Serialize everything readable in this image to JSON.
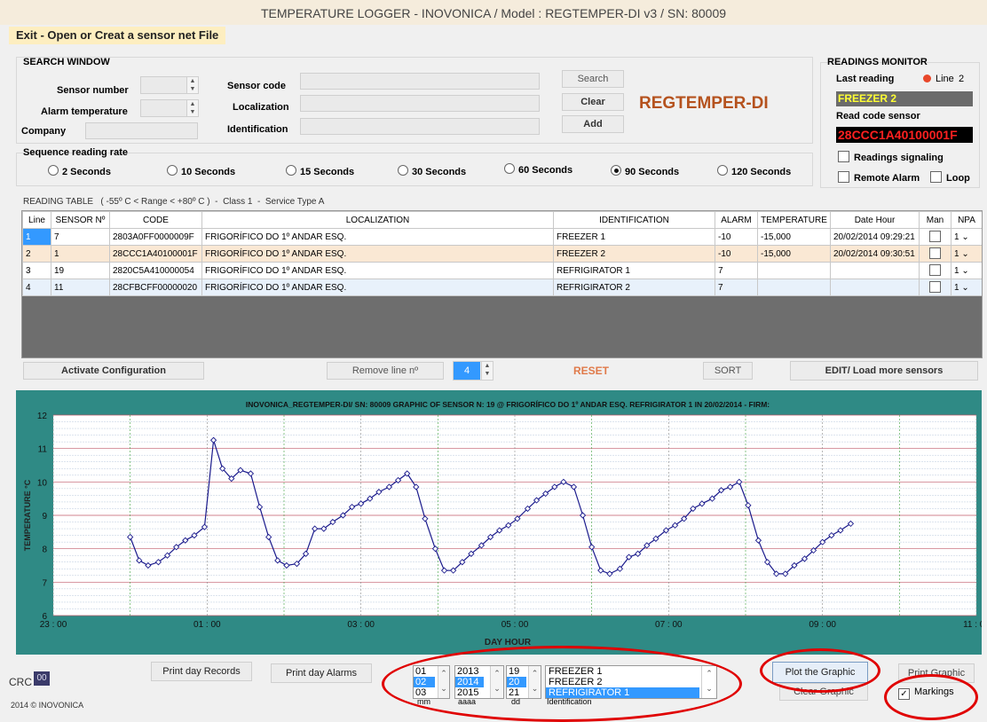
{
  "window": {
    "title": "TEMPERATURE LOGGER  - INOVONICA  / Model : REGTEMPER-DI v3  / SN:  80009"
  },
  "menu": {
    "exit_label": "Exit - Open or Creat a sensor net File"
  },
  "search": {
    "title": "SEARCH WINDOW",
    "sensor_number_label": "Sensor number",
    "alarm_temperature_label": "Alarm temperature",
    "company_label": "Company",
    "sensor_code_label": "Sensor code",
    "localization_label": "Localization",
    "identification_label": "Identification",
    "search_button": "Search",
    "clear_button": "Clear",
    "add_button": "Add",
    "brand": "REGTEMPER-DI"
  },
  "monitor": {
    "title": "READINGS MONITOR",
    "last_reading_label": "Last reading",
    "line_label": "Line",
    "line_value": "2",
    "last_reading_value": "FREEZER 2",
    "read_code_label": "Read code sensor",
    "read_code_value": "28CCC1A40100001F",
    "signaling_label": "Readings signaling",
    "remote_alarm_label": "Remote Alarm",
    "loop_label": "Loop"
  },
  "rate": {
    "title": "Sequence reading rate",
    "options": [
      "2 Seconds",
      "10 Seconds",
      "15 Seconds",
      "30 Seconds",
      "60 Seconds",
      "90 Seconds",
      "120 Seconds"
    ],
    "selected": "90 Seconds"
  },
  "table": {
    "caption": "READING TABLE   ( -55º C < Range < +80º C )  -  Class 1  -  Service Type A",
    "headers": [
      "Line",
      "SENSOR Nº",
      "CODE",
      "LOCALIZATION",
      "IDENTIFICATION",
      "ALARM",
      "TEMPERATURE",
      "Date Hour",
      "Man",
      "NPA"
    ],
    "rows": [
      {
        "line": "1",
        "sensor": "7",
        "code": "2803A0FF0000009F",
        "loc": "FRIGORÍFICO DO 1º ANDAR ESQ.",
        "ident": "FREEZER 1",
        "alarm": "-10",
        "temp": "-15,000",
        "date": "20/02/2014 09:29:21",
        "npa": "1"
      },
      {
        "line": "2",
        "sensor": "1",
        "code": "28CCC1A40100001F",
        "loc": "FRIGORÍFICO DO 1º ANDAR ESQ.",
        "ident": "FREEZER 2",
        "alarm": "-10",
        "temp": "-15,000",
        "date": "20/02/2014 09:30:51",
        "npa": "1"
      },
      {
        "line": "3",
        "sensor": "19",
        "code": "2820C5A410000054",
        "loc": "FRIGORÍFICO DO 1º ANDAR ESQ.",
        "ident": "REFRIGIRATOR 1",
        "alarm": "7",
        "temp": "",
        "date": "",
        "npa": "1"
      },
      {
        "line": "4",
        "sensor": "11",
        "code": "28CFBCFF00000020",
        "loc": "FRIGORÍFICO DO 1º ANDAR ESQ.",
        "ident": "REFRIGIRATOR 2",
        "alarm": "7",
        "temp": "",
        "date": "",
        "npa": "1"
      }
    ]
  },
  "actions": {
    "activate": "Activate Configuration",
    "remove_line": "Remove line  nº",
    "remove_value": "4",
    "reset": "RESET",
    "sort": "SORT",
    "edit": "EDIT/ Load more sensors"
  },
  "bottom": {
    "crc_label": "CRC",
    "crc_value": "00",
    "copyright": "2014 © INOVONICA",
    "print_records": "Print day Records",
    "print_alarms": "Print day Alarms",
    "month_list": [
      "01",
      "02",
      "03"
    ],
    "month_label": "mm",
    "year_list": [
      "2013",
      "2014",
      "2015"
    ],
    "year_label": "aaaa",
    "day_list": [
      "19",
      "20",
      "21"
    ],
    "day_label": "dd",
    "ident_list": [
      "FREEZER 1",
      "FREEZER 2",
      "REFRIGIRATOR 1"
    ],
    "ident_label": "Identification",
    "plot": "Plot the Graphic",
    "clear_graphic": "Clear Graphic",
    "print_graphic": "Print Graphic",
    "markings": "Markings"
  },
  "colors": {
    "chart_bg": "#2f8a85",
    "line": "#1a1a8c",
    "brand": "#b5521e",
    "highlight": "#e00000"
  },
  "chart_data": {
    "type": "line",
    "title": "INOVONICA_REGTEMPER-DI/ SN: 80009 GRAPHIC OF SENSOR N: 19 @ FRIGORÍFICO DO 1º ANDAR ESQ. REFRIGIRATOR 1 IN 20/02/2014 - FIRM:",
    "xlabel": "DAY HOUR",
    "ylabel": "TEMPERATURE °C",
    "ylim": [
      6,
      12
    ],
    "yticks": [
      "6",
      "7",
      "8",
      "9",
      "10",
      "11",
      "12"
    ],
    "xticks": [
      "23 : 00",
      "01 : 00",
      "03 : 00",
      "05 : 00",
      "07 : 00",
      "09 : 00",
      "11 : 00"
    ],
    "grid": true,
    "series": [
      {
        "x": [
          "00:00",
          "00:07",
          "00:14",
          "00:22",
          "00:29",
          "00:36",
          "00:43",
          "00:50",
          "00:58",
          "01:05",
          "01:12",
          "01:19",
          "01:26",
          "01:34",
          "01:41",
          "01:48",
          "01:55",
          "02:02",
          "02:10",
          "02:17",
          "02:24",
          "02:31",
          "02:38",
          "02:46",
          "02:53",
          "03:00",
          "03:07",
          "03:14",
          "03:22",
          "03:29",
          "03:36",
          "03:43",
          "03:50",
          "03:58",
          "04:05",
          "04:12",
          "04:19",
          "04:26",
          "04:34",
          "04:41",
          "04:48",
          "04:55",
          "05:02",
          "05:10",
          "05:17",
          "05:24",
          "05:31",
          "05:38",
          "05:46",
          "05:53",
          "06:00",
          "06:07",
          "06:14",
          "06:22",
          "06:29",
          "06:36",
          "06:43",
          "06:50",
          "06:58",
          "07:05",
          "07:12",
          "07:19",
          "07:26",
          "07:34",
          "07:41",
          "07:48",
          "07:55",
          "08:02",
          "08:10",
          "08:17",
          "08:24",
          "08:31",
          "08:38",
          "08:46",
          "08:53",
          "09:00",
          "09:07",
          "09:14",
          "09:22"
        ],
        "values": [
          8.35,
          7.65,
          7.5,
          7.6,
          7.8,
          8.05,
          8.25,
          8.4,
          8.65,
          11.25,
          10.4,
          10.1,
          10.35,
          10.25,
          9.25,
          8.35,
          7.65,
          7.5,
          7.55,
          7.85,
          8.6,
          8.6,
          8.8,
          9.0,
          9.25,
          9.35,
          9.5,
          9.7,
          9.85,
          10.05,
          10.25,
          9.85,
          8.9,
          8.0,
          7.35,
          7.35,
          7.6,
          7.85,
          8.1,
          8.35,
          8.55,
          8.7,
          8.9,
          9.2,
          9.45,
          9.65,
          9.85,
          10.0,
          9.85,
          9.0,
          8.05,
          7.35,
          7.25,
          7.4,
          7.75,
          7.85,
          8.1,
          8.3,
          8.55,
          8.7,
          8.9,
          9.2,
          9.35,
          9.5,
          9.75,
          9.85,
          10.0,
          9.3,
          8.25,
          7.6,
          7.25,
          7.25,
          7.5,
          7.7,
          7.95,
          8.2,
          8.4,
          8.55,
          8.75
        ]
      }
    ]
  }
}
